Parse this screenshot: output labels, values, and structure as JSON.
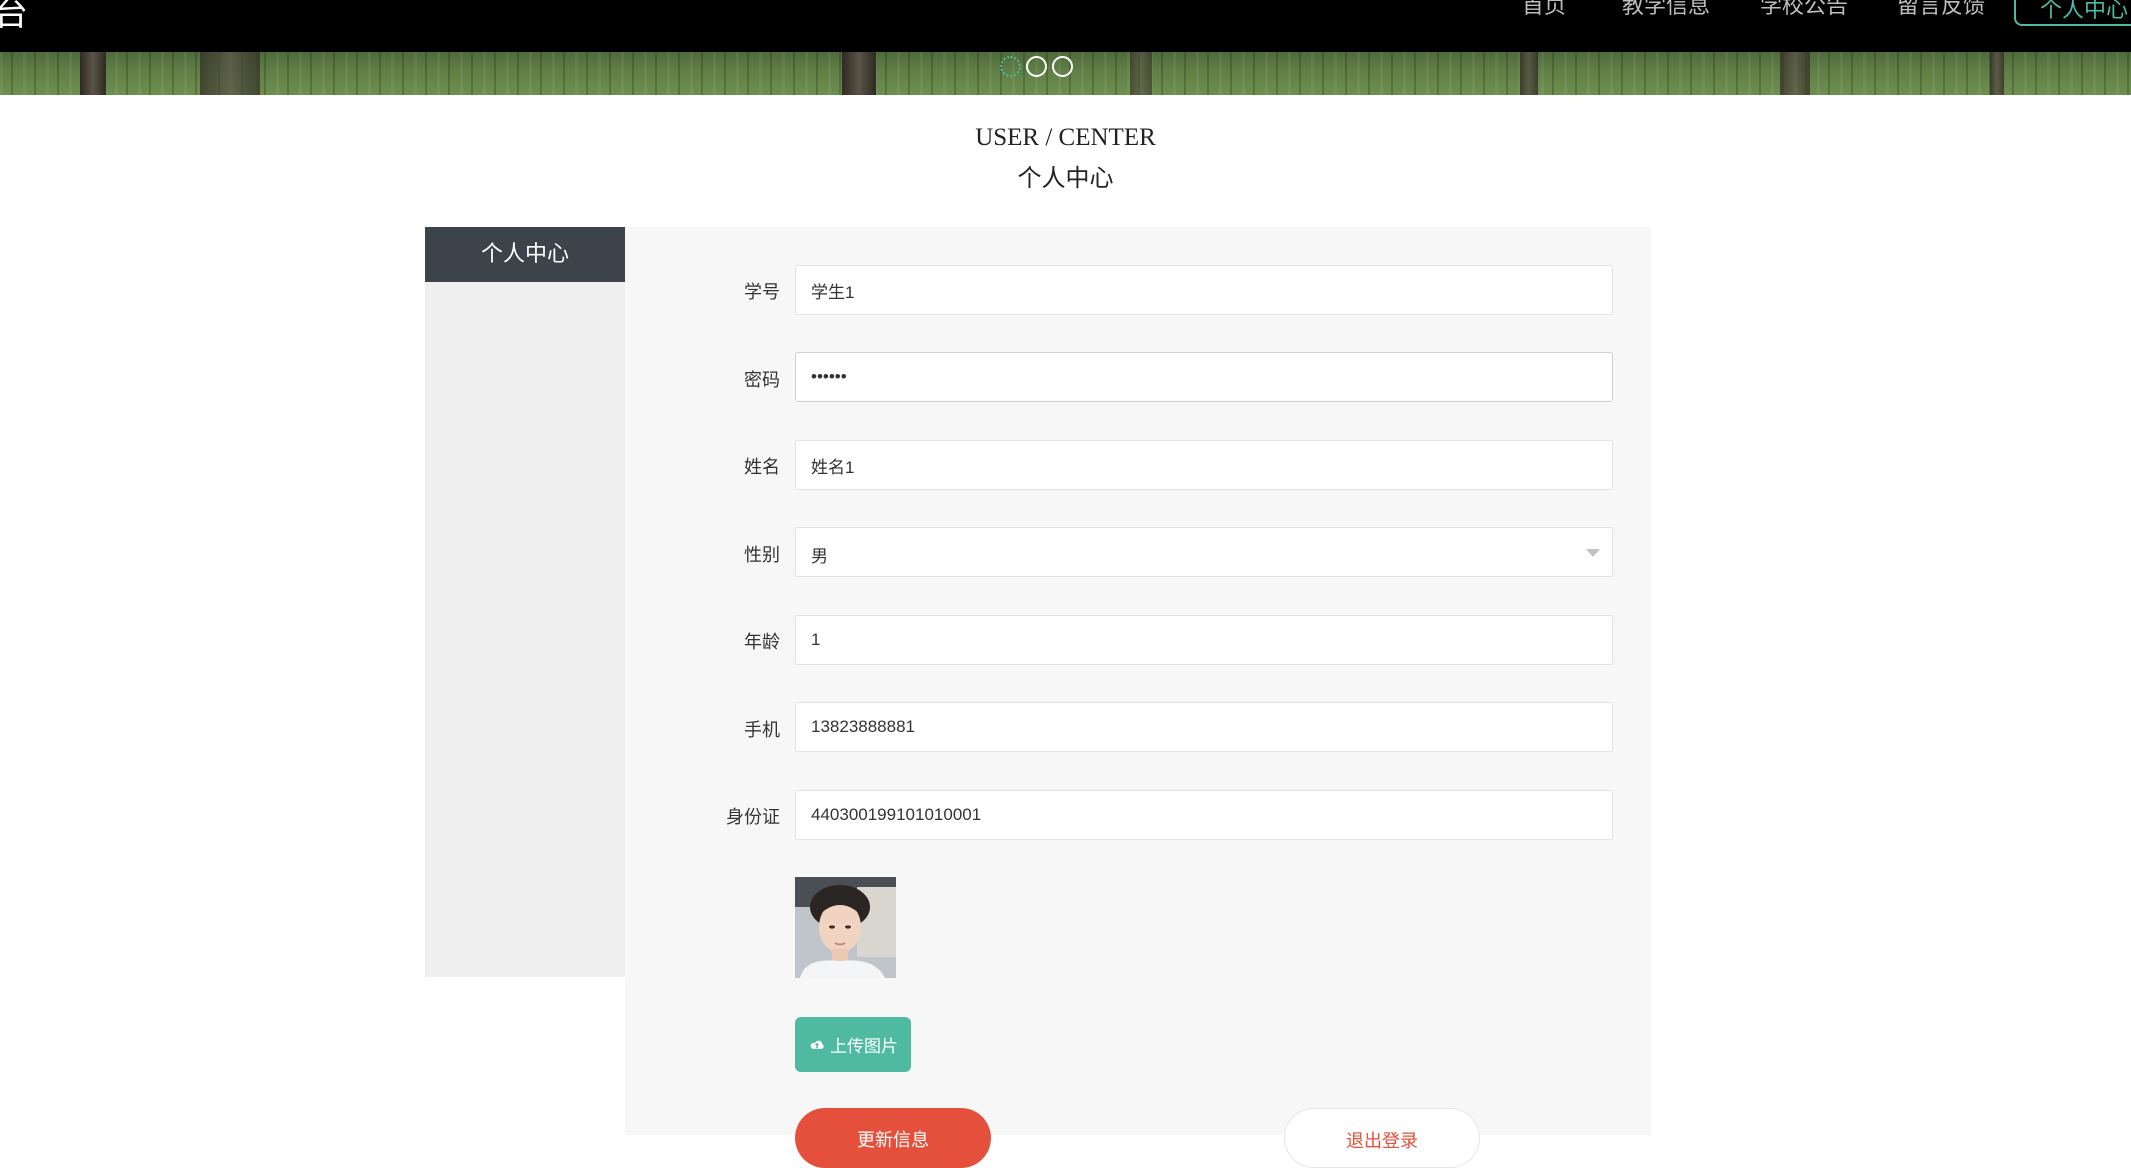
{
  "nav": {
    "brand_fragment": "台",
    "items": [
      "首页",
      "教学信息",
      "学校公告",
      "留言反馈"
    ],
    "active": "个人中心"
  },
  "banner": {
    "slide_count": 3,
    "active_index": 0
  },
  "heading": {
    "en": "USER / CENTER",
    "cn": "个人中心"
  },
  "sidebar": {
    "title": "个人中心"
  },
  "form": {
    "fields": [
      {
        "label": "学号",
        "value": "学生1"
      },
      {
        "label": "密码",
        "value": "••••••"
      },
      {
        "label": "姓名",
        "value": "姓名1"
      },
      {
        "label": "性别",
        "value": "男"
      },
      {
        "label": "年龄",
        "value": "1"
      },
      {
        "label": "手机",
        "value": "13823888881"
      },
      {
        "label": "身份证",
        "value": "440300199101010001"
      }
    ],
    "upload_label": "上传图片",
    "update_label": "更新信息",
    "logout_label": "退出登录"
  },
  "colors": {
    "accent": "#4fb9a2",
    "danger": "#e4503b",
    "sidebar_head": "#3d434a"
  },
  "icons": {
    "upload": "cloud-upload-icon",
    "select": "chevron-down-icon"
  }
}
